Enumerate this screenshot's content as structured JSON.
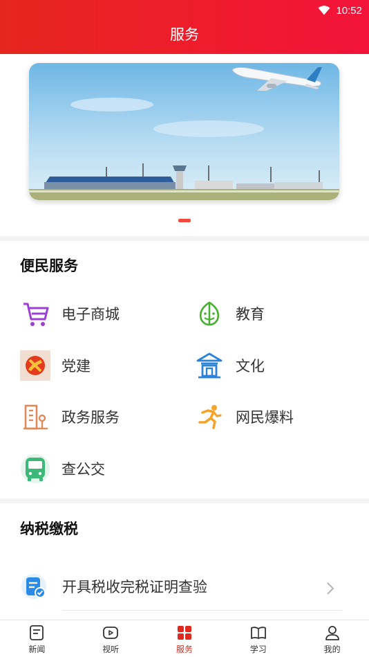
{
  "status": {
    "time": "10:52"
  },
  "header": {
    "title": "服务"
  },
  "banner": {
    "slides": 1,
    "active_index": 0
  },
  "convenience": {
    "title": "便民服务",
    "items": [
      {
        "label": "电子商城",
        "icon": "shopping-cart-icon"
      },
      {
        "label": "教育",
        "icon": "leaf-smile-icon"
      },
      {
        "label": "党建",
        "icon": "party-emblem-icon"
      },
      {
        "label": "文化",
        "icon": "pavilion-icon"
      },
      {
        "label": "政务服务",
        "icon": "government-building-icon"
      },
      {
        "label": "网民爆料",
        "icon": "running-person-icon"
      },
      {
        "label": "查公交",
        "icon": "bus-icon"
      }
    ]
  },
  "tax": {
    "title": "纳税缴税",
    "items": [
      {
        "label": "开具税收完税证明查验",
        "icon": "tax-certificate-icon"
      }
    ]
  },
  "tabbar": {
    "active": "服务",
    "tabs": [
      {
        "label": "新闻",
        "icon": "news-icon"
      },
      {
        "label": "视听",
        "icon": "video-icon"
      },
      {
        "label": "服务",
        "icon": "services-icon"
      },
      {
        "label": "学习",
        "icon": "book-icon"
      },
      {
        "label": "我的",
        "icon": "profile-icon"
      }
    ]
  },
  "colors": {
    "header": "#ee1c2c",
    "accent": "#e02a1f",
    "divider": "#f3f3f3"
  }
}
